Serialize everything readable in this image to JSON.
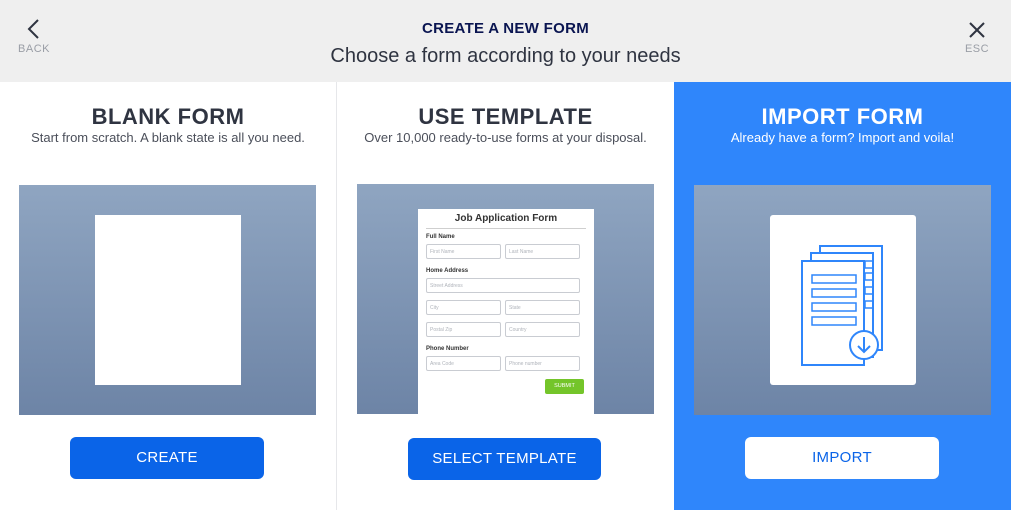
{
  "header": {
    "title": "CREATE A NEW FORM",
    "subtitle": "Choose a form according to your needs",
    "back_label": "BACK",
    "esc_label": "ESC"
  },
  "options": [
    {
      "title": "BLANK FORM",
      "description": "Start from scratch. A blank state is all you need.",
      "button": "CREATE"
    },
    {
      "title": "USE TEMPLATE",
      "description": "Over 10,000 ready-to-use forms at your disposal.",
      "button": "SELECT TEMPLATE",
      "template_preview": {
        "title": "Job Application Form",
        "full_name_label": "Full Name",
        "first_name": "First Name",
        "last_name": "Last Name",
        "home_address_label": "Home Address",
        "street_address": "Street Address",
        "city": "City",
        "state": "State",
        "postal_zip": "Postal Zip",
        "country": "Country",
        "phone_label": "Phone Number",
        "area_code": "Area Code",
        "phone_number": "Phone number",
        "submit": "SUBMIT"
      }
    },
    {
      "title": "IMPORT FORM",
      "description": "Already have a form? Import and voila!",
      "button": "IMPORT"
    }
  ],
  "colors": {
    "accent": "#0a64e8",
    "selected_panel": "#2f86fb",
    "header_bg": "#efefef",
    "submit_green": "#74c52a"
  },
  "icons": {
    "back": "chevron-left-icon",
    "esc": "close-icon",
    "import": "document-download-icon"
  }
}
